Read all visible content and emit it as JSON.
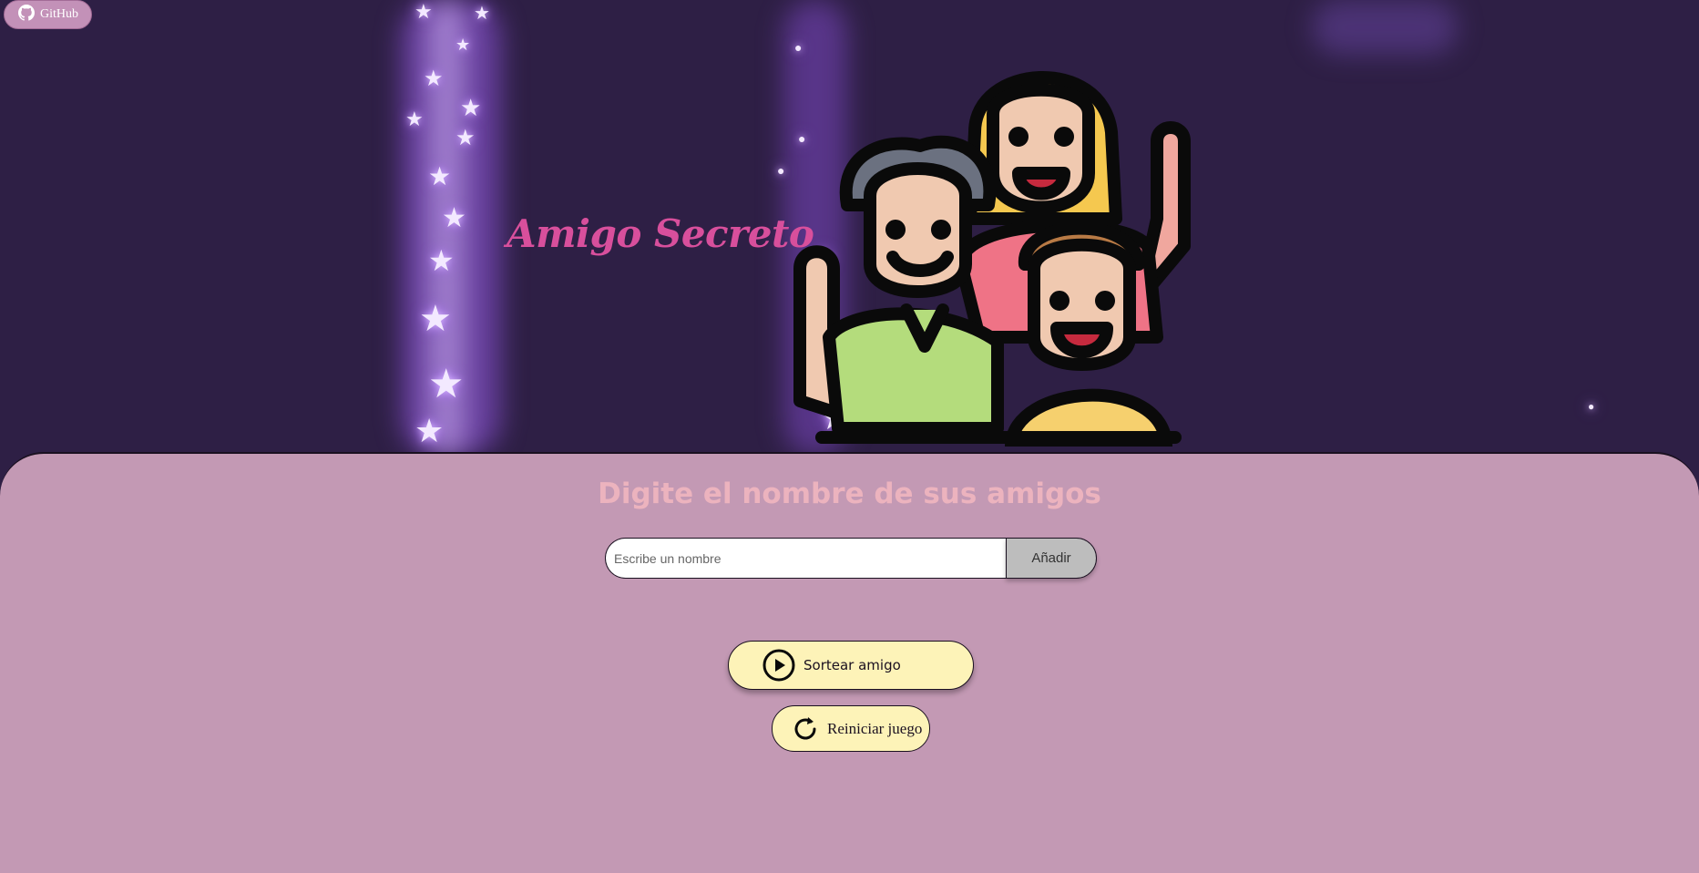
{
  "header": {
    "github_label": "GitHub",
    "title": "Amigo Secreto"
  },
  "form": {
    "heading": "Digite el nombre de sus amigos",
    "input_placeholder": "Escribe un nombre",
    "input_value": "",
    "add_label": "Añadir"
  },
  "actions": {
    "draw_label": "Sortear amigo",
    "reset_label": "Reiniciar juego"
  },
  "icons": {
    "github": "github-icon",
    "draw": "play-circle-icon",
    "reset": "refresh-icon"
  },
  "colors": {
    "background": "#2e1f45",
    "panel": "#c399b4",
    "title": "#d84f9c",
    "heading": "#ecb3be",
    "button": "#fdf3b8",
    "github_button": "#c391b8"
  }
}
